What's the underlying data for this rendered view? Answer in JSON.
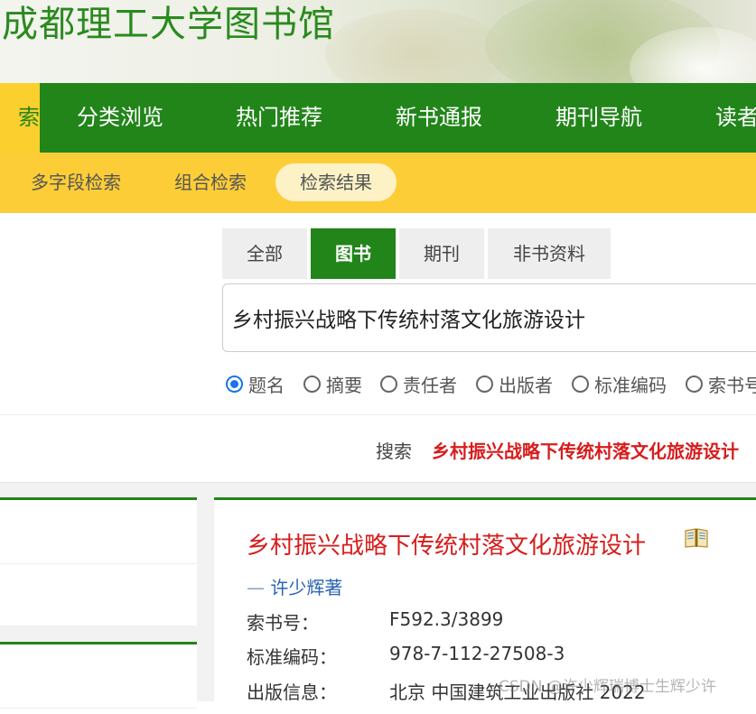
{
  "header": {
    "site_title": "成都理工大学图书馆"
  },
  "main_nav": {
    "items": [
      {
        "label": "索",
        "active": true
      },
      {
        "label": "分类浏览",
        "active": false
      },
      {
        "label": "热门推荐",
        "active": false
      },
      {
        "label": "新书通报",
        "active": false
      },
      {
        "label": "期刊导航",
        "active": false
      },
      {
        "label": "读者",
        "active": false
      }
    ]
  },
  "sub_nav": {
    "items": [
      {
        "label": "多字段检索",
        "active": false
      },
      {
        "label": "组合检索",
        "active": false
      },
      {
        "label": "检索结果",
        "active": true
      }
    ]
  },
  "search": {
    "type_tabs": [
      {
        "label": "全部",
        "active": false
      },
      {
        "label": "图书",
        "active": true
      },
      {
        "label": "期刊",
        "active": false
      },
      {
        "label": "非书资料",
        "active": false
      }
    ],
    "query_value": "乡村振兴战略下传统村落文化旅游设计",
    "field_options": [
      {
        "label": "题名",
        "checked": true
      },
      {
        "label": "摘要",
        "checked": false
      },
      {
        "label": "责任者",
        "checked": false
      },
      {
        "label": "出版者",
        "checked": false
      },
      {
        "label": "标准编码",
        "checked": false
      },
      {
        "label": "索书号",
        "checked": false
      }
    ]
  },
  "summary": {
    "prefix": "搜索",
    "query": "乡村振兴战略下传统村落文化旅游设计"
  },
  "result": {
    "title": "乡村振兴战略下传统村落文化旅游设计",
    "author_dash": "—",
    "author": "许少辉著",
    "fields": [
      {
        "label": "索书号：",
        "value": "F592.3/3899"
      },
      {
        "label": "标准编码：",
        "value": "978-7-112-27508-3"
      },
      {
        "label": "出版信息：",
        "value": "北京  中国建筑工业出版社  2022"
      }
    ]
  },
  "watermark": "CSDN @许少辉瑞博士生辉少许",
  "colors": {
    "primary_green": "#22851a",
    "accent_yellow": "#fccd37",
    "title_red": "#d61d1d",
    "author_blue": "#2a64b2",
    "radio_blue": "#1a73e8"
  },
  "icons": {
    "result_badge": "book-icon"
  }
}
